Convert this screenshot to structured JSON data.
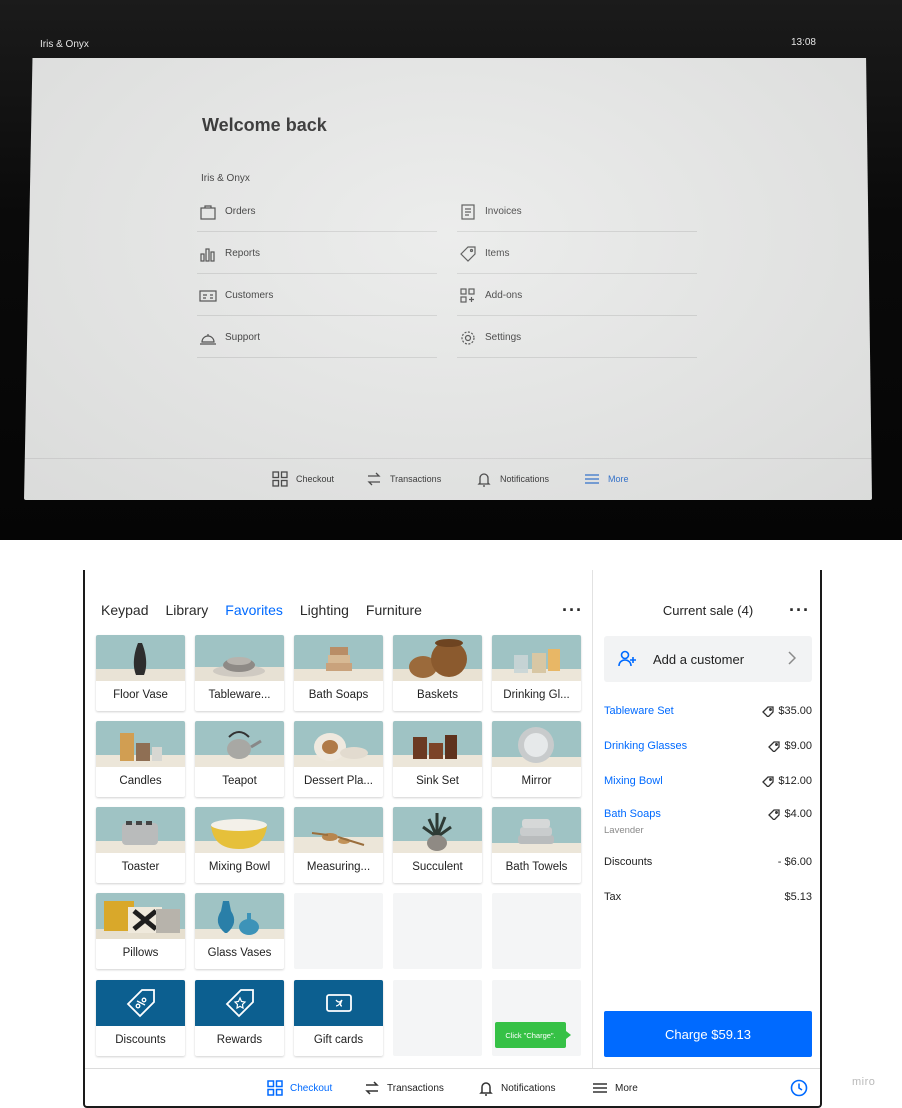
{
  "tablet": {
    "business_name": "Iris & Onyx",
    "time": "13:08",
    "title": "Welcome back",
    "section": "Iris & Onyx",
    "menu": [
      {
        "label": "Orders",
        "icon": "bag-icon"
      },
      {
        "label": "Invoices",
        "icon": "invoice-icon"
      },
      {
        "label": "Reports",
        "icon": "bar-chart-icon"
      },
      {
        "label": "Items",
        "icon": "tag-icon"
      },
      {
        "label": "Customers",
        "icon": "id-card-icon"
      },
      {
        "label": "Add-ons",
        "icon": "grid-plus-icon"
      },
      {
        "label": "Support",
        "icon": "bell-service-icon"
      },
      {
        "label": "Settings",
        "icon": "gear-icon"
      }
    ],
    "nav": [
      {
        "label": "Checkout",
        "icon": "grid-icon"
      },
      {
        "label": "Transactions",
        "icon": "arrows-swap-icon"
      },
      {
        "label": "Notifications",
        "icon": "bell-icon"
      },
      {
        "label": "More",
        "icon": "menu-icon",
        "active": true
      }
    ]
  },
  "pos": {
    "tabs": [
      {
        "label": "Keypad"
      },
      {
        "label": "Library"
      },
      {
        "label": "Favorites",
        "active": true
      },
      {
        "label": "Lighting"
      },
      {
        "label": "Furniture"
      }
    ],
    "tiles": [
      {
        "label": "Floor Vase"
      },
      {
        "label": "Tableware..."
      },
      {
        "label": "Bath Soaps"
      },
      {
        "label": "Baskets"
      },
      {
        "label": "Drinking Gl..."
      },
      {
        "label": "Candles"
      },
      {
        "label": "Teapot"
      },
      {
        "label": "Dessert Pla..."
      },
      {
        "label": "Sink Set"
      },
      {
        "label": "Mirror"
      },
      {
        "label": "Toaster"
      },
      {
        "label": "Mixing Bowl"
      },
      {
        "label": "Measuring..."
      },
      {
        "label": "Succulent"
      },
      {
        "label": "Bath Towels"
      },
      {
        "label": "Pillows"
      },
      {
        "label": "Glass Vases"
      },
      {
        "label": "Discounts",
        "icon": "discount-tag-icon"
      },
      {
        "label": "Rewards",
        "icon": "reward-tag-icon"
      },
      {
        "label": "Gift cards",
        "icon": "gift-card-icon"
      }
    ],
    "tooltip": "Click \"Charge\".",
    "cart": {
      "title": "Current sale (4)",
      "add_customer": "Add a customer",
      "items": [
        {
          "name": "Tableware Set",
          "price": "$35.00",
          "note": ""
        },
        {
          "name": "Drinking Glasses",
          "price": "$9.00",
          "note": ""
        },
        {
          "name": "Mixing Bowl",
          "price": "$12.00",
          "note": ""
        },
        {
          "name": "Bath Soaps",
          "price": "$4.00",
          "note": "Lavender"
        }
      ],
      "discounts_label": "Discounts",
      "discounts_value": "- $6.00",
      "tax_label": "Tax",
      "tax_value": "$5.13",
      "charge_label": "Charge $59.13"
    },
    "nav": [
      {
        "label": "Checkout",
        "icon": "grid-icon",
        "active": true
      },
      {
        "label": "Transactions",
        "icon": "arrows-swap-icon"
      },
      {
        "label": "Notifications",
        "icon": "bell-icon"
      },
      {
        "label": "More",
        "icon": "menu-icon"
      }
    ]
  },
  "watermark": "miro",
  "colors": {
    "accent": "#006aff",
    "tile_special": "#0c5f90",
    "tooltip": "#36c146"
  }
}
